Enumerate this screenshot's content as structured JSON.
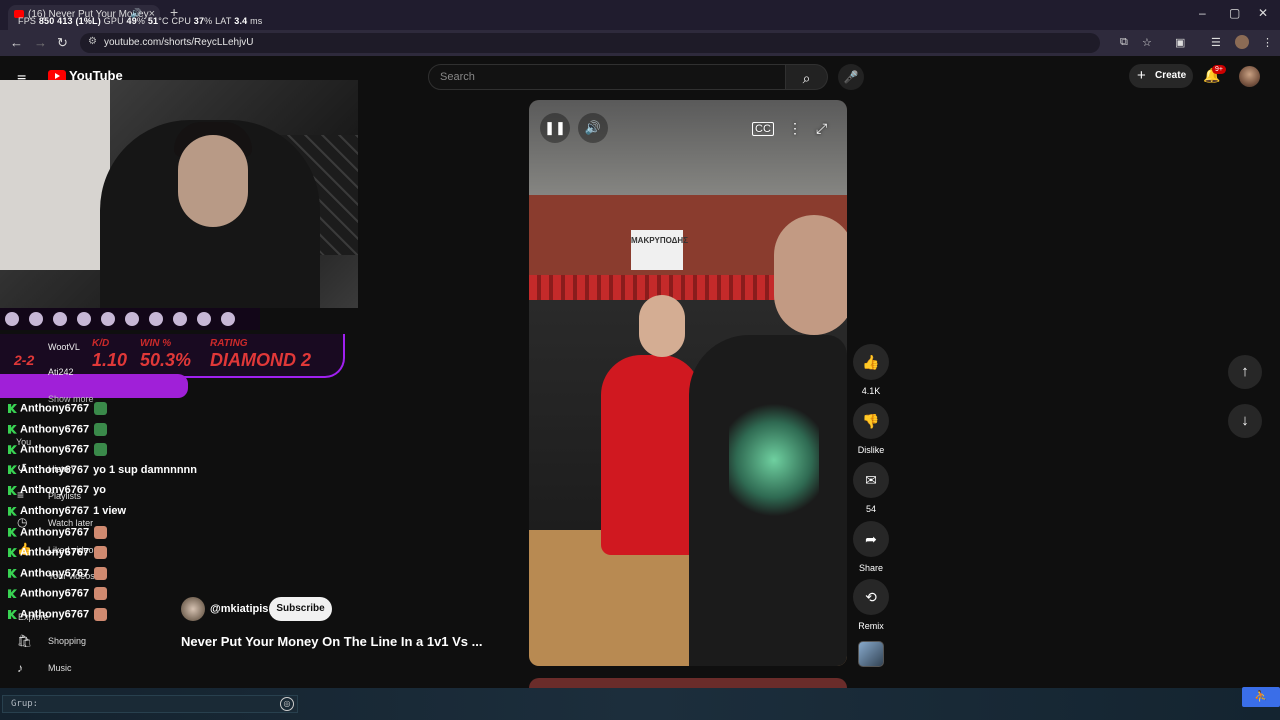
{
  "browser": {
    "tab_title": "(16) Never Put Your Money",
    "new_tab": "+",
    "url": "youtube.com/shorts/ReycLLehjvU",
    "window_controls": [
      "–",
      "▢",
      "✕"
    ]
  },
  "perf_overlay": {
    "fps_label": "FPS",
    "fps_value": "850",
    "fps_extra": "413 (1%L)",
    "gpu_label": "GPU",
    "gpu_value": "49",
    "gpu_unit": "%",
    "gpu_temp": "51",
    "temp_unit": "°C",
    "cpu_label": "CPU",
    "cpu_value": "37",
    "cpu_unit": "%",
    "lat_label": "LAT",
    "lat_value": "3.4",
    "lat_unit": "ms"
  },
  "youtube": {
    "logo_text": "YouTube",
    "search_placeholder": "Search",
    "create_label": "Create",
    "notification_badge": "9+"
  },
  "stream_overlay": {
    "streamer_name": "WootVL",
    "viewer_name": "Ati242",
    "show_more": "Show more",
    "kd_label": "K/D",
    "kd_value": "1.10",
    "win_label": "WIN %",
    "win_value": "50.3%",
    "rating_label": "RATING",
    "rating_value": "DIAMOND 2",
    "score_value": "2-2"
  },
  "chat": [
    {
      "user": "Anthony6767",
      "msg": "",
      "emote_color": "#3a8a4a"
    },
    {
      "user": "Anthony6767",
      "msg": "",
      "emote_color": "#3a8a4a"
    },
    {
      "user": "Anthony6767",
      "msg": "",
      "emote_color": "#3a8a4a"
    },
    {
      "user": "Anthony6767",
      "msg": "yo 1 sup damnnnnn",
      "emote_color": ""
    },
    {
      "user": "Anthony6767",
      "msg": "yo",
      "emote_color": ""
    },
    {
      "user": "Anthony6767",
      "msg": "1 view",
      "emote_color": ""
    },
    {
      "user": "Anthony6767",
      "msg": "",
      "emote_color": "#d08a70"
    },
    {
      "user": "Anthony6767",
      "msg": "",
      "emote_color": "#d08a70"
    },
    {
      "user": "Anthony6767",
      "msg": "",
      "emote_color": "#d08a70"
    },
    {
      "user": "Anthony6767",
      "msg": "",
      "emote_color": "#d08a70"
    },
    {
      "user": "Anthony6767",
      "msg": "",
      "emote_color": "#d08a70"
    }
  ],
  "sidebar": {
    "you": "You",
    "history": "History",
    "playlists": "Playlists",
    "watch_later": "Watch later",
    "liked_videos": "Liked videos",
    "your_videos": "Your videos",
    "explore": "Explore",
    "shopping": "Shopping",
    "music": "Music"
  },
  "short": {
    "channel": "@mkiatipis",
    "subscribe_label": "Subscribe",
    "title": "Never Put Your Money On The Line In a 1v1 Vs ...",
    "banner_text": "ΜΑΚΡΥΠΟΔΗΣ",
    "progress": 0.23,
    "likes": "4.1K",
    "dislike_label": "Dislike",
    "comments": "54",
    "share_label": "Share",
    "remix_label": "Remix"
  },
  "bottom": {
    "group_placeholder": "Grup:"
  },
  "colors": {
    "accent_red": "#ff0000",
    "overlay_purple": "#a020f0",
    "chat_green": "#39d353"
  }
}
